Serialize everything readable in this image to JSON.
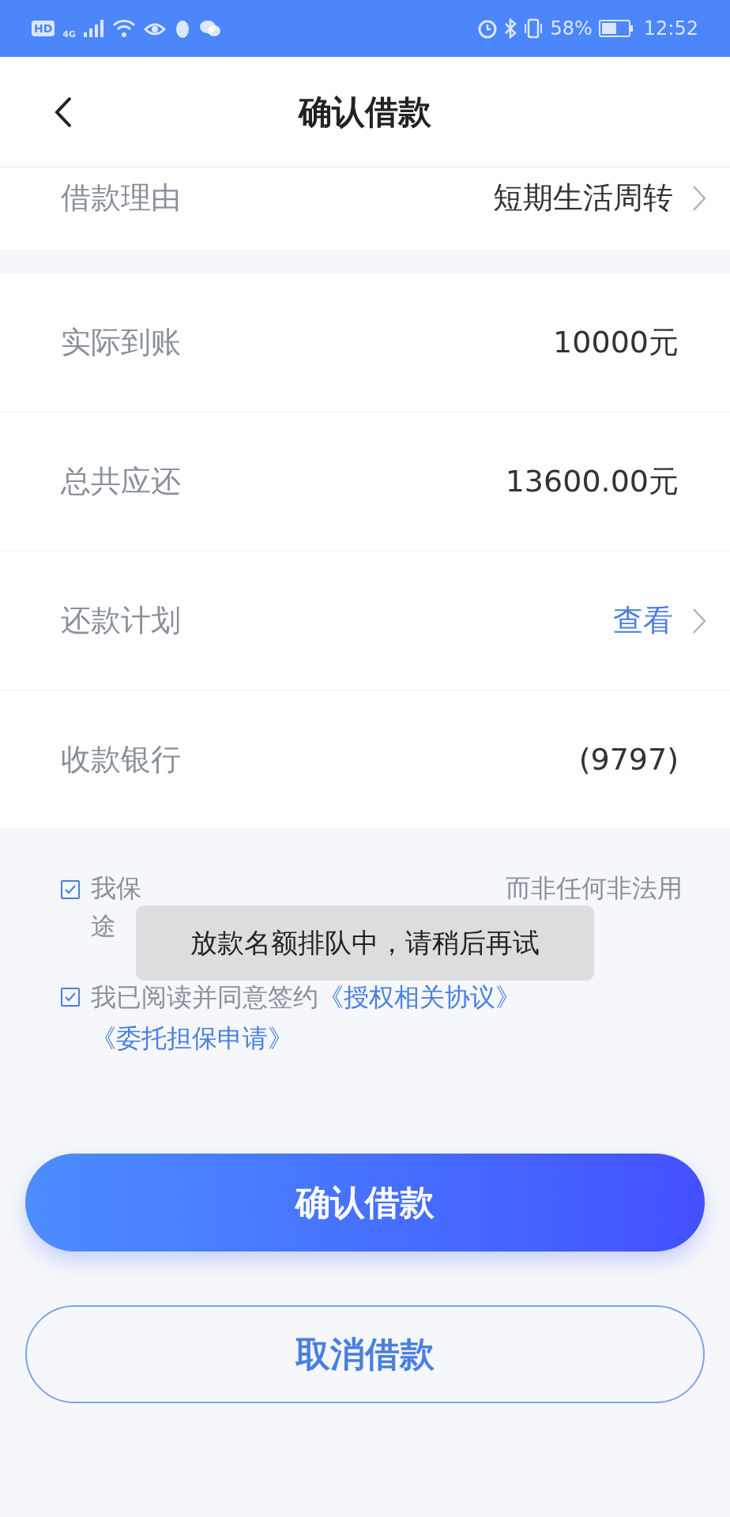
{
  "status_bar": {
    "hd": "HD",
    "network": "4G",
    "battery_text": "58%",
    "time": "12:52"
  },
  "header": {
    "title": "确认借款"
  },
  "rows": [
    {
      "label": "借款理由",
      "value": "短期生活周转",
      "kind": "plain",
      "chevron": true
    },
    {
      "label": "实际到账",
      "value": "10000元",
      "kind": "plain",
      "chevron": false
    },
    {
      "label": "总共应还",
      "value": "13600.00元",
      "kind": "plain",
      "chevron": false
    },
    {
      "label": "还款计划",
      "value": "查看",
      "kind": "link",
      "chevron": true
    },
    {
      "label": "收款银行",
      "value": "(9797)",
      "kind": "plain",
      "chevron": false
    }
  ],
  "agreements": [
    {
      "checked": true,
      "kind": "covered",
      "lines": [
        [
          "我保",
          "而非任何非法用"
        ],
        [
          "途"
        ]
      ]
    },
    {
      "checked": true,
      "kind": "text",
      "parts": [
        {
          "kind": "plain",
          "text": "我已阅读并同意签约"
        },
        {
          "kind": "link",
          "text": "《授权相关协议》"
        },
        {
          "kind": "link",
          "text": "《委托担保申请》"
        }
      ]
    }
  ],
  "toast": {
    "text": "放款名额排队中，请稍后再试"
  },
  "buttons": [
    {
      "label": "确认借款",
      "kind": "primary"
    },
    {
      "label": "取消借款",
      "kind": "outline"
    }
  ]
}
